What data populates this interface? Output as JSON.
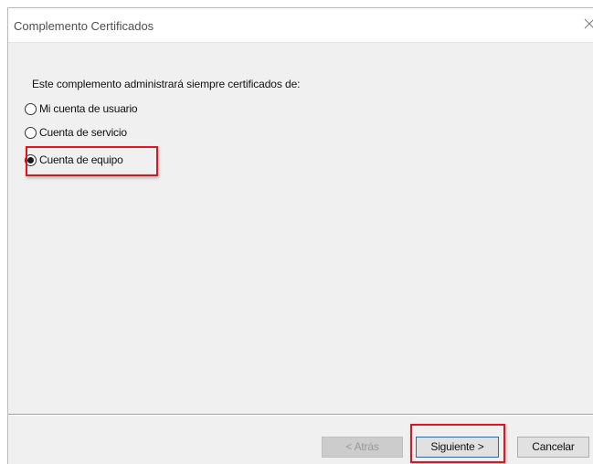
{
  "window": {
    "title": "Complemento Certificados"
  },
  "content": {
    "heading": "Este complemento administrará siempre certificados de:",
    "options": [
      {
        "label": "Mi cuenta de usuario",
        "selected": false
      },
      {
        "label": "Cuenta de servicio",
        "selected": false
      },
      {
        "label": "Cuenta de equipo",
        "selected": true
      }
    ]
  },
  "buttons": {
    "back_label": "< Atrás",
    "next_label": "Siguiente >",
    "cancel_label": "Cancelar"
  },
  "colors": {
    "highlight": "#e0141e",
    "dialog_bg": "#f0f0f0",
    "default_button_border": "#0078d7"
  },
  "icons": {
    "close": "close-icon"
  }
}
